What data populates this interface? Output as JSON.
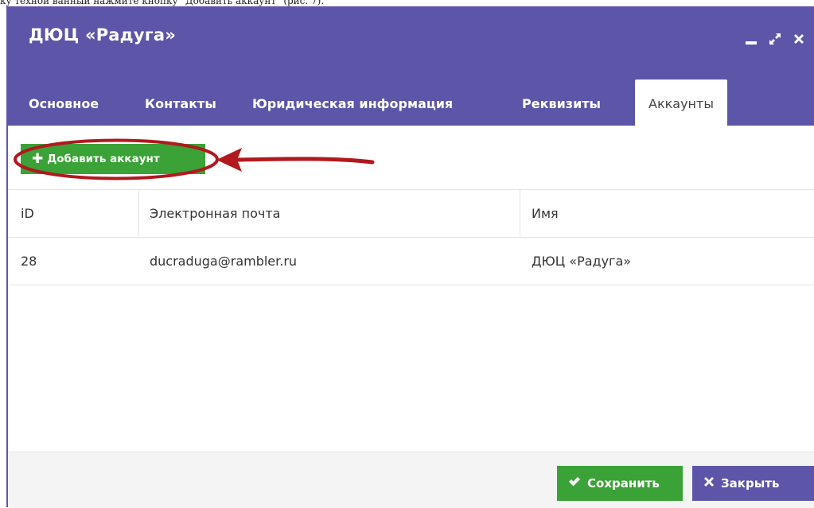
{
  "document": {
    "caption": "ку техной ванный нажмите кнопку \"Добавить аккаунт\" (рис. 7)."
  },
  "window": {
    "title": "ДЮЦ «Радуга»",
    "controls": [
      "minimize-icon",
      "expand-icon",
      "close-icon"
    ]
  },
  "tabs": [
    {
      "label": "Основное",
      "active": false
    },
    {
      "label": "Контакты",
      "active": false
    },
    {
      "label": "Юридическая информация",
      "active": false
    },
    {
      "label": "Реквизиты",
      "active": false
    },
    {
      "label": "Аккаунты",
      "active": true
    }
  ],
  "toolbar": {
    "add_icon": "plus-icon",
    "add_label": "Добавить аккаунт"
  },
  "table": {
    "headers": {
      "id": "iD",
      "email": "Электронная почта",
      "name": "Имя"
    },
    "rows": [
      {
        "id": "28",
        "email": "ducraduga@rambler.ru",
        "name": "ДЮЦ «Радуга»"
      }
    ]
  },
  "footer": {
    "save_icon": "checkmark-icon",
    "save_label": "Сохранить",
    "close_icon": "x-icon",
    "close_label": "Закрыть"
  },
  "colors": {
    "header_bg": "#5d55a8",
    "accent_green": "#3aa236",
    "annotation_red": "#b0191e"
  }
}
